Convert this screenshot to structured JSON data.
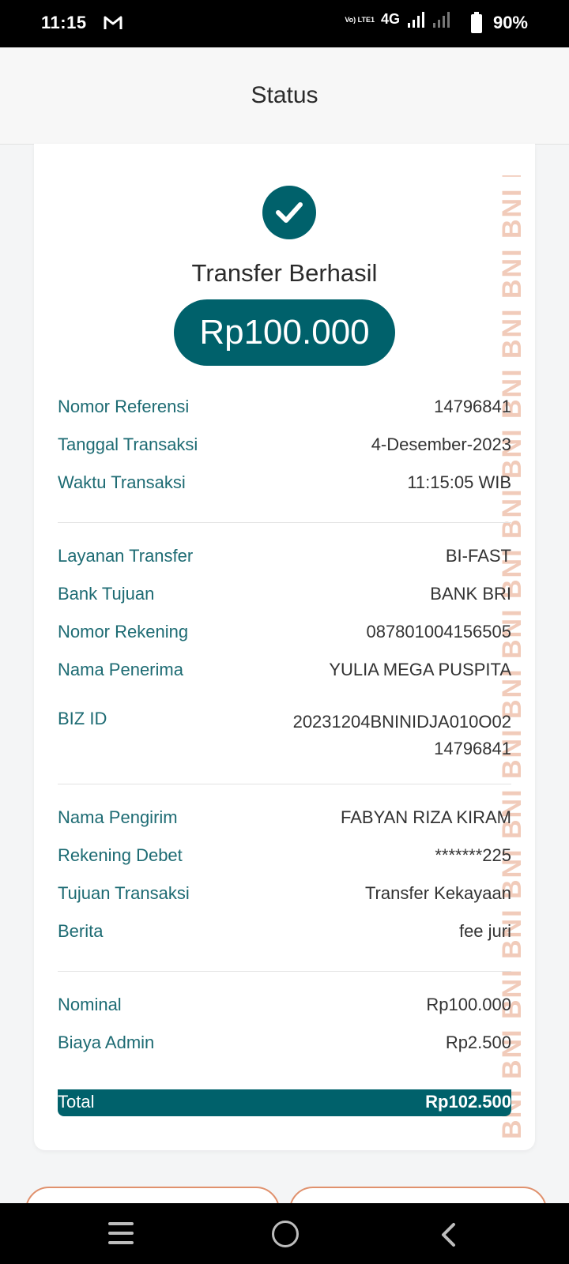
{
  "status_bar": {
    "time": "11:15",
    "network": "4G",
    "volte": "Vo) LTE1",
    "battery": "90%"
  },
  "header": {
    "title": "Status"
  },
  "result": {
    "title": "Transfer Berhasil",
    "amount": "Rp100.000"
  },
  "section1": [
    {
      "label": "Nomor Referensi",
      "value": "14796841"
    },
    {
      "label": "Tanggal Transaksi",
      "value": "4-Desember-2023"
    },
    {
      "label": "Waktu Transaksi",
      "value": "11:15:05 WIB"
    }
  ],
  "section2": [
    {
      "label": "Layanan Transfer",
      "value": "BI-FAST"
    },
    {
      "label": "Bank Tujuan",
      "value": "BANK BRI"
    },
    {
      "label": "Nomor Rekening",
      "value": "087801004156505"
    },
    {
      "label": "Nama Penerima",
      "value": "YULIA MEGA PUSPITA"
    }
  ],
  "biz": {
    "label": "BIZ ID",
    "value_line1": "20231204BNINIDJA010O02",
    "value_line2": "14796841"
  },
  "section3": [
    {
      "label": "Nama Pengirim",
      "value": "FABYAN RIZA KIRAM"
    },
    {
      "label": "Rekening Debet",
      "value": "*******225"
    },
    {
      "label": "Tujuan Transaksi",
      "value": "Transfer Kekayaan"
    },
    {
      "label": "Berita",
      "value": "fee juri"
    }
  ],
  "section4": [
    {
      "label": "Nominal",
      "value": "Rp100.000"
    },
    {
      "label": "Biaya Admin",
      "value": "Rp2.500"
    }
  ],
  "total": {
    "label": "Total",
    "value": "Rp102.500"
  },
  "watermark": "BNI BNI BNI BNI BNI BNI BNI BNI BNI BNI BNI BNI BNI BNI BNI BNI BNI BNI",
  "colors": {
    "brand": "#00616b",
    "accent": "#e0916d"
  },
  "icons": [
    "gmail-icon",
    "signal-icon",
    "battery-icon",
    "check-icon",
    "menu-icon",
    "home-icon",
    "back-icon"
  ]
}
